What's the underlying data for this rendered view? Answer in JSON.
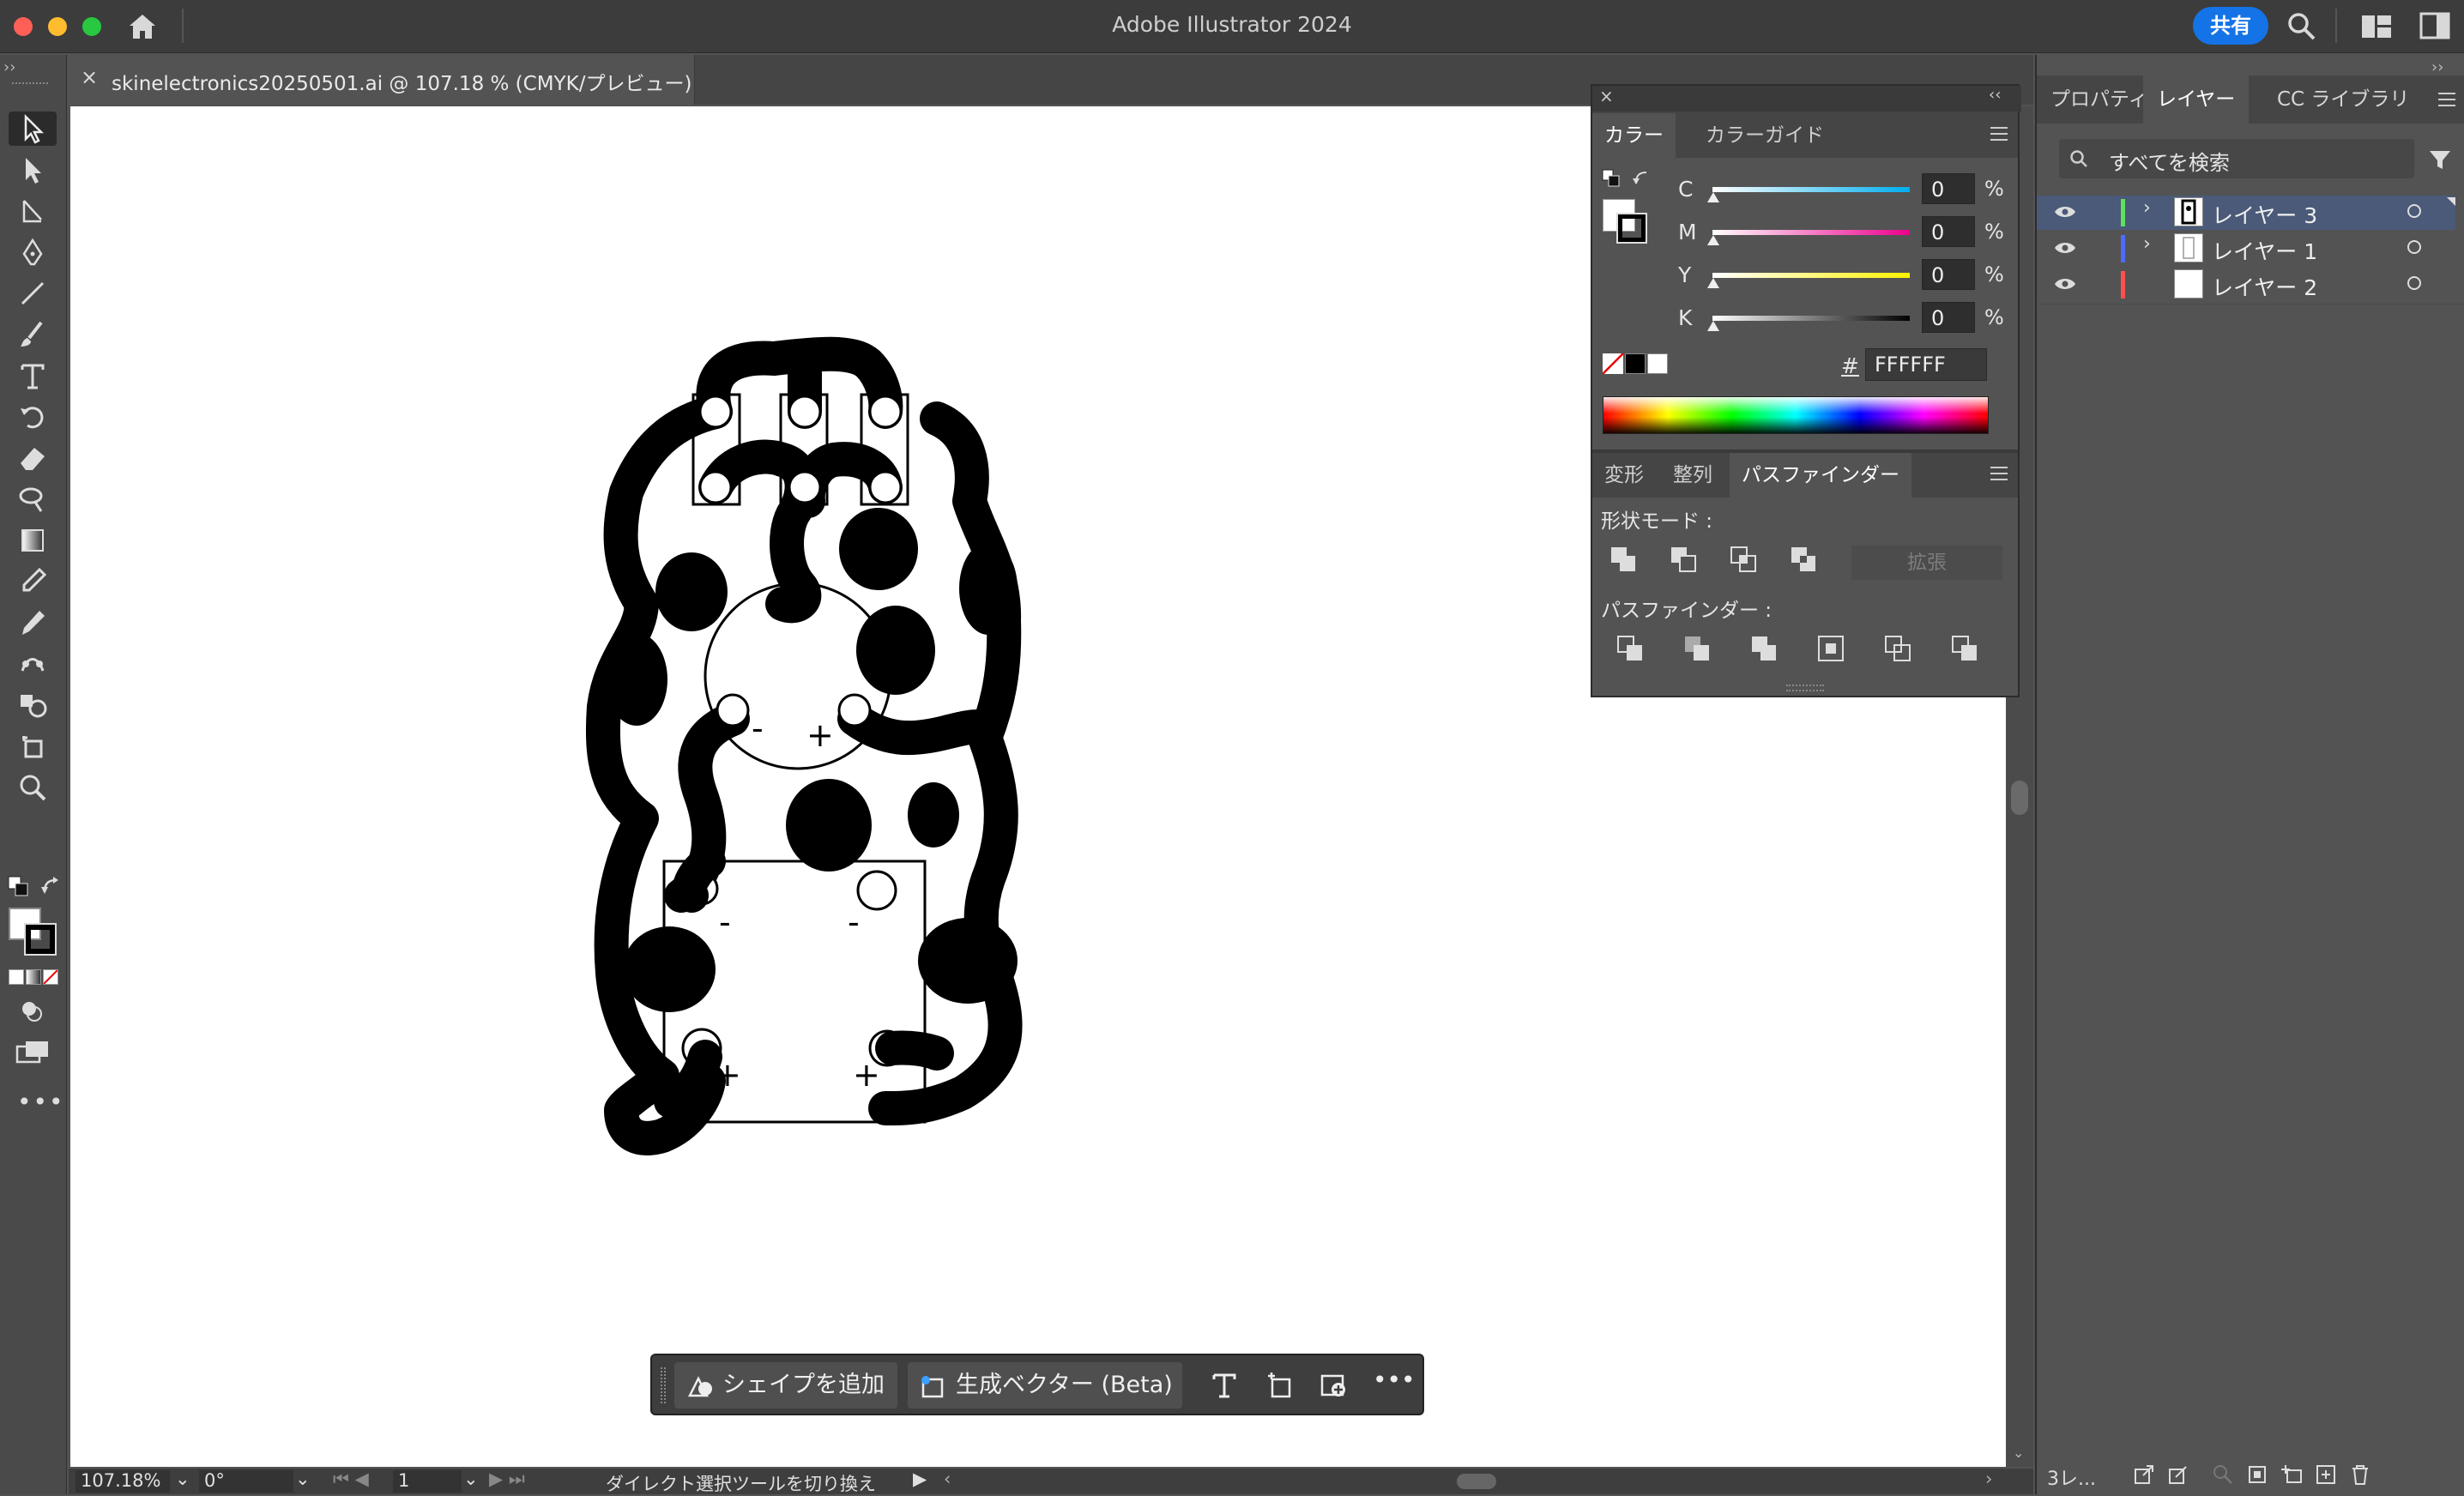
{
  "app": {
    "title": "Adobe Illustrator 2024",
    "share_label": "共有"
  },
  "document": {
    "tab_title": "skinelectronics20250501.ai @ 107.18 % (CMYK/プレビュー)",
    "close_glyph": "×"
  },
  "status_bar": {
    "zoom": "107.18%",
    "rotation": "0°",
    "artboard": "1",
    "tool_hint": "ダイレクト選択ツールを切り換え"
  },
  "color_panel": {
    "tabs": [
      "カラー",
      "カラーガイド"
    ],
    "channels": [
      {
        "label": "C",
        "value": "0",
        "unit": "%",
        "color": "#00aeef"
      },
      {
        "label": "M",
        "value": "0",
        "unit": "%",
        "color": "#ec008c"
      },
      {
        "label": "Y",
        "value": "0",
        "unit": "%",
        "color": "#fff200"
      },
      {
        "label": "K",
        "value": "0",
        "unit": "%",
        "color": "#000000"
      }
    ],
    "hex_prefix": "#",
    "hex_value": "FFFFFF"
  },
  "pathfinder_panel": {
    "tabs": [
      "変形",
      "整列",
      "パスファインダー"
    ],
    "shape_modes_label": "形状モード :",
    "expand_label": "拡張",
    "pathfinders_label": "パスファインダー :"
  },
  "right_panel": {
    "tabs": [
      "プロパティ",
      "レイヤー",
      "CC ライブラリ"
    ],
    "search_placeholder": "すべてを検索",
    "layers": [
      {
        "name": "レイヤー 3",
        "color": "#5fe05f",
        "selected": true,
        "expandable": true
      },
      {
        "name": "レイヤー 1",
        "color": "#4f6bff",
        "selected": false,
        "expandable": true
      },
      {
        "name": "レイヤー 2",
        "color": "#ff4f4f",
        "selected": false,
        "expandable": false
      }
    ],
    "footer_label": "3レ..."
  },
  "context_bar": {
    "add_shape_label": "シェイプを追加",
    "gen_vector_label": "生成ベクター (Beta)"
  },
  "artwork": {
    "labels": {
      "minus": "-",
      "plus": "+"
    }
  },
  "colors": {
    "accent": "#1473e6",
    "panel": "#454545",
    "selection": "#4a5a78"
  }
}
